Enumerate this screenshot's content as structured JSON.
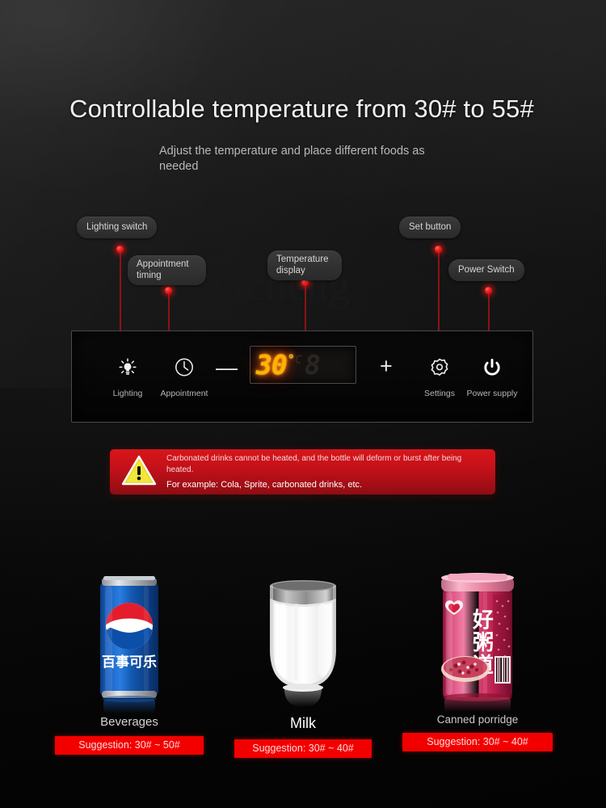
{
  "header": {
    "title": "Controllable temperature from 30# to 55#",
    "subtitle": "Adjust the temperature and place different foods as needed"
  },
  "watermark": {
    "text": "yicheng"
  },
  "callouts": [
    {
      "id": "lighting-switch",
      "label": "Lighting switch"
    },
    {
      "id": "appointment-timing",
      "label": "Appointment timing"
    },
    {
      "id": "temperature-display",
      "label": "Temperature display"
    },
    {
      "id": "set-button",
      "label": "Set button"
    },
    {
      "id": "power-switch",
      "label": "Power Switch"
    }
  ],
  "panel": {
    "buttons": [
      {
        "id": "lighting",
        "icon": "lightbulb-icon",
        "label": "Lighting"
      },
      {
        "id": "appointment",
        "icon": "clock-icon",
        "label": "Appointment"
      },
      {
        "id": "decrease",
        "icon": "minus-icon",
        "label": ""
      },
      {
        "id": "increase",
        "icon": "plus-icon",
        "label": ""
      },
      {
        "id": "settings",
        "icon": "gear-icon",
        "label": "Settings"
      },
      {
        "id": "power-supply",
        "icon": "power-icon",
        "label": "Power supply"
      }
    ],
    "display": {
      "value": "30",
      "unit": "°C",
      "blank_digit": "8",
      "on_color": "#ffb300",
      "off_color": "#2b2522"
    }
  },
  "warning": {
    "icon": "warning-triangle-icon",
    "line1": "Carbonated drinks cannot be heated, and the bottle will deform or burst after being heated.",
    "line2": "For example: Cola, Sprite, carbonated drinks, etc.",
    "color": "#d8161a"
  },
  "products": [
    {
      "id": "beverages",
      "name": "Beverages",
      "suggestion": "Suggestion: 30# ~ 50#",
      "image": "pepsi-can-image"
    },
    {
      "id": "milk",
      "name": "Milk",
      "suggestion": "Suggestion: 30# ~ 40#",
      "image": "milk-glass-image"
    },
    {
      "id": "canned-porridge",
      "name": "Canned porridge",
      "suggestion": "Suggestion: 30# ~ 40#",
      "image": "porridge-can-image"
    }
  ],
  "product_art": {
    "pepsi_label": "百事可乐",
    "porridge_label": "好粥道"
  },
  "accent": {
    "dot": "#f31a1a",
    "line": "#8d1216",
    "badge": "#f20000"
  }
}
